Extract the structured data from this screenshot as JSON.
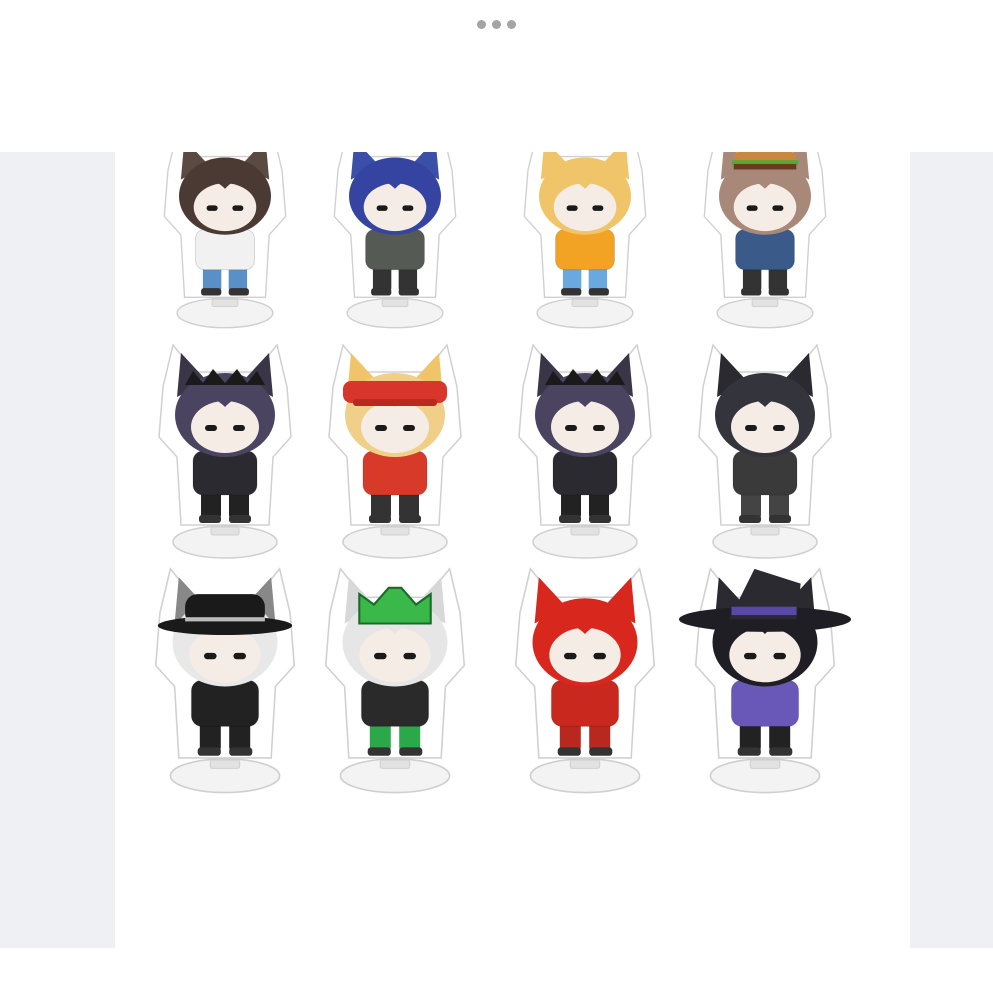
{
  "toolbar": {
    "more_icon": "more-dots-icon"
  },
  "product_image": {
    "content": "acrylic-standee-figures",
    "rows": [
      [
        {
          "name": "brown-cat-boy",
          "ears": "#5a4a42",
          "hair": "#4a3a33",
          "shirt": "#f1f1f1",
          "pants": "#5a90c8",
          "accessory": "none"
        },
        {
          "name": "blue-hair-masked",
          "ears": "#3b4fa8",
          "hair": "#3444a0",
          "shirt": "#555a55",
          "pants": "#333333",
          "accessory": "none"
        },
        {
          "name": "blonde-fox",
          "ears": "#f0c56a",
          "hair": "#f0c56a",
          "shirt": "#f2a324",
          "pants": "#6aa8e0",
          "accessory": "none"
        },
        {
          "name": "burger-hat-cat",
          "ears": "#a88878",
          "hair": "#a88878",
          "shirt": "#3a5a8a",
          "pants": "#333333",
          "accessory": "burger"
        }
      ],
      [
        {
          "name": "dark-purple-cat",
          "ears": "#3a3648",
          "hair": "#4a4460",
          "shirt": "#2a2a30",
          "pants": "#222222",
          "accessory": "crown"
        },
        {
          "name": "roblox-cap-fox",
          "ears": "#f0c56a",
          "hair": "#f0d088",
          "shirt": "#d83a2a",
          "pants": "#333333",
          "accessory": "cap"
        },
        {
          "name": "dark-purple-cat-2",
          "ears": "#3a3648",
          "hair": "#4a4460",
          "shirt": "#2a2a30",
          "pants": "#222222",
          "accessory": "crown"
        },
        {
          "name": "black-cat-small",
          "ears": "#2a2a30",
          "hair": "#34343c",
          "shirt": "#3a3a3a",
          "pants": "#444444",
          "accessory": "none"
        }
      ],
      [
        {
          "name": "bucket-hat-cat",
          "ears": "#888888",
          "hair": "#e8e8e8",
          "shirt": "#222222",
          "pants": "#222222",
          "accessory": "buckethat"
        },
        {
          "name": "green-crown-bunny",
          "ears": "#d8d8d8",
          "hair": "#e6e6e6",
          "shirt": "#2a2a2a",
          "pants": "#2aa84a",
          "accessory": "greencrown"
        },
        {
          "name": "red-cat",
          "ears": "#d8281e",
          "hair": "#d8281e",
          "shirt": "#c8281e",
          "pants": "#b8281e",
          "accessory": "none"
        },
        {
          "name": "witch-hat-cat",
          "ears": "#2a2a30",
          "hair": "#1e1e24",
          "shirt": "#6a58b8",
          "pants": "#222222",
          "accessory": "witchhat"
        }
      ]
    ]
  },
  "caption": {
    "text": "",
    "visible": false
  }
}
